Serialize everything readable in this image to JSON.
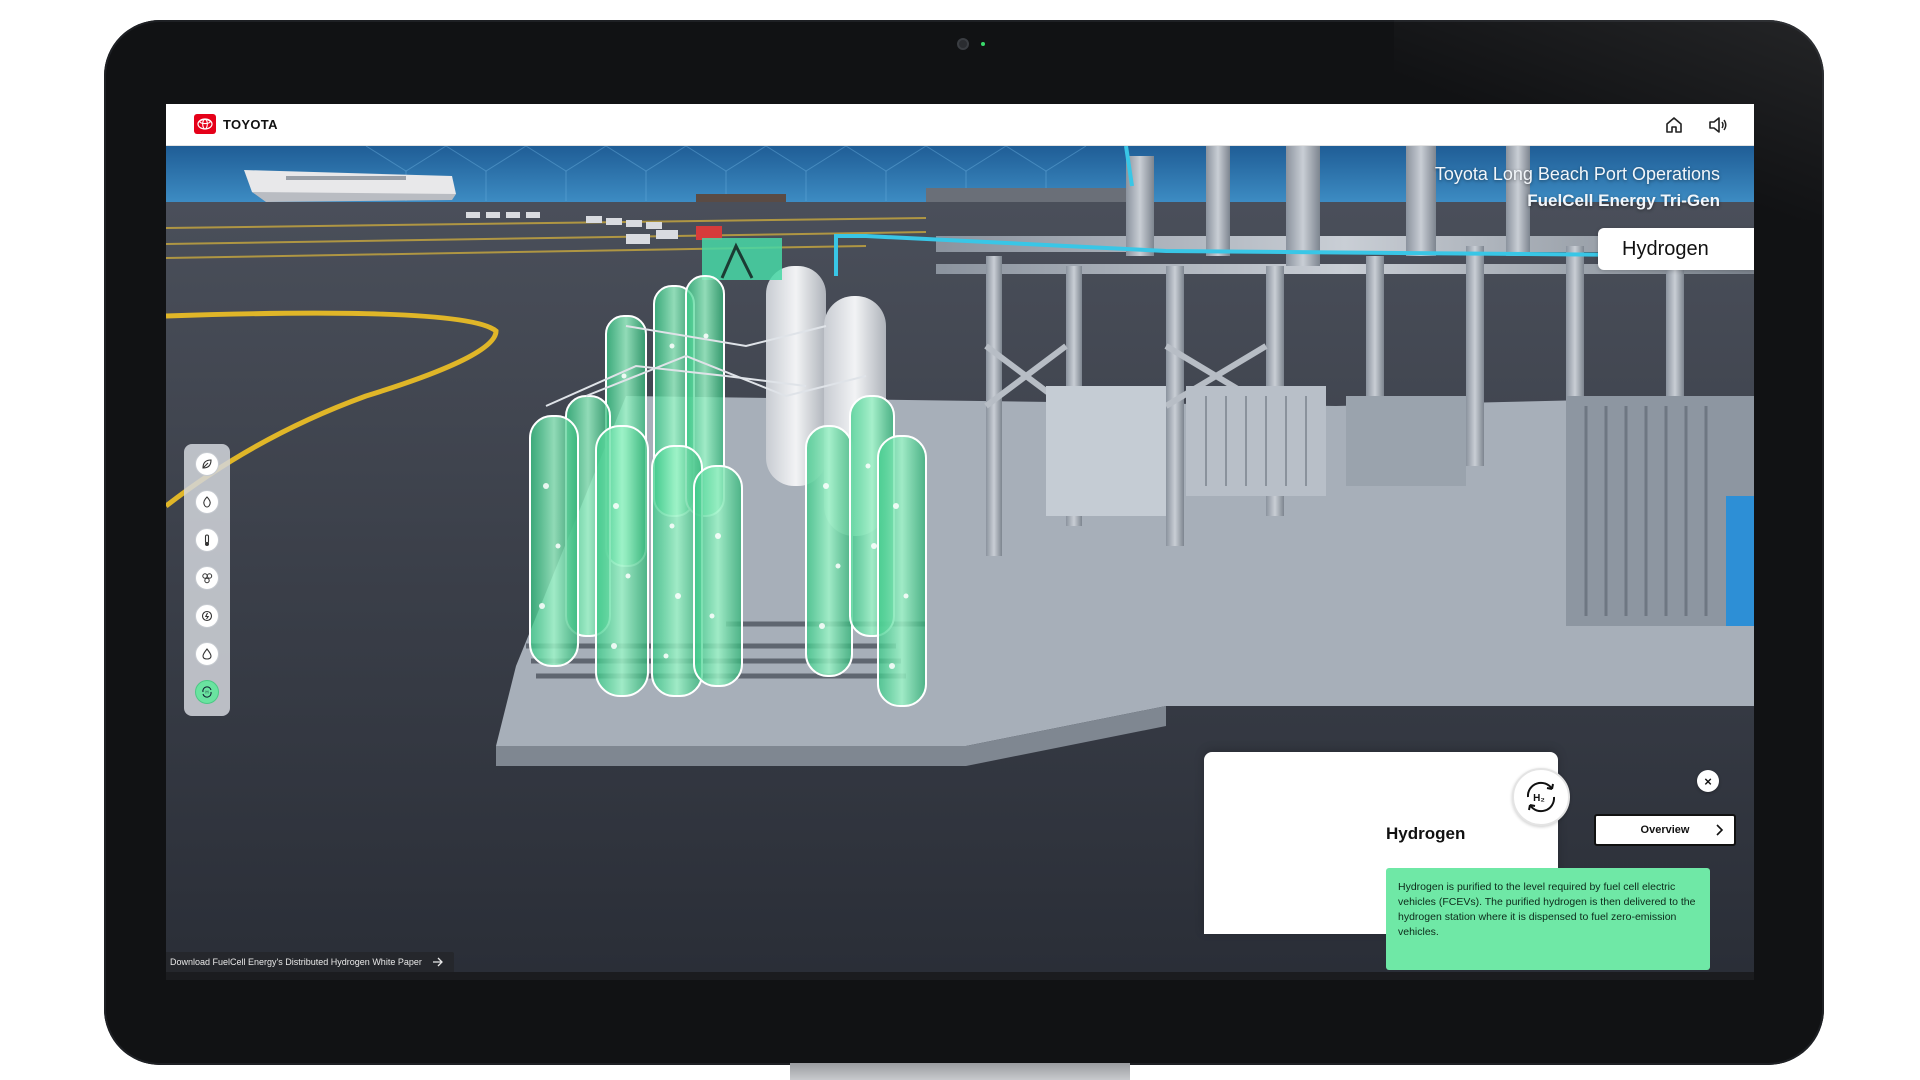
{
  "brand": {
    "name": "TOYOTA",
    "color": "#e50019"
  },
  "header": {
    "home_icon": "home-icon",
    "sound_icon": "speaker-icon"
  },
  "scene": {
    "title_line1": "Toyota Long Beach Port Operations",
    "title_line2": "FuelCell Energy Tri-Gen",
    "section_label": "Hydrogen",
    "download_link": "Download FuelCell Energy's Distributed Hydrogen White Paper"
  },
  "rail": {
    "items": [
      {
        "icon": "leaf-icon",
        "active": false
      },
      {
        "icon": "gas-flame-icon",
        "active": false
      },
      {
        "icon": "thermometer-icon",
        "active": false
      },
      {
        "icon": "molecule-icon",
        "active": false
      },
      {
        "icon": "power-cycle-icon",
        "active": false
      },
      {
        "icon": "water-drop-icon",
        "active": false
      },
      {
        "icon": "hydrogen-cycle-icon",
        "active": true
      }
    ]
  },
  "panel": {
    "icon_text": "H₂",
    "title": "Hydrogen",
    "overview_label": "Overview",
    "close_label": "×",
    "body": "Hydrogen is purified to the level required by fuel cell electric vehicles (FCEVs). The purified hydrogen is then delivered to the hydrogen station where it is dispensed to fuel zero-emission vehicles.",
    "accent_color": "#6fe8a6"
  }
}
